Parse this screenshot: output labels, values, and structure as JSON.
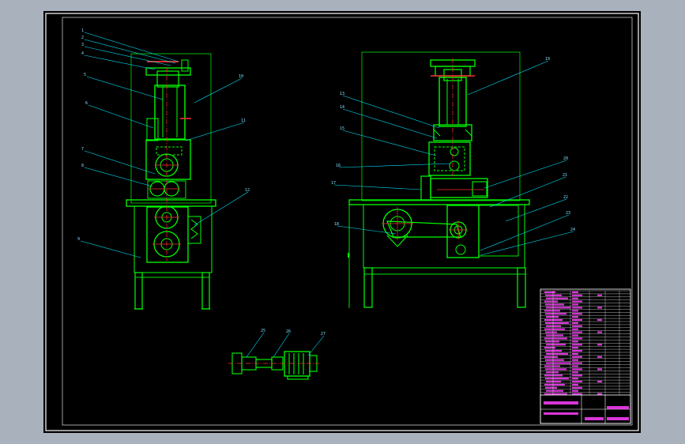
{
  "drawing": {
    "background_color": "#a9b1bd",
    "paper_color": "#000000",
    "frame_color": "#ffffff",
    "part_color": "#00ff00",
    "leader_color": "#00e5ff",
    "center_color": "#ff3030",
    "table_color": "#ff40ff"
  },
  "callouts": {
    "left_view": [
      "1",
      "2",
      "3",
      "4",
      "5",
      "6",
      "7",
      "8",
      "9",
      "10",
      "11",
      "12"
    ],
    "right_view": [
      "13",
      "14",
      "15",
      "16",
      "17",
      "18",
      "19",
      "20",
      "21",
      "22",
      "23",
      "24"
    ],
    "bottom_view": [
      "25",
      "26",
      "27"
    ]
  }
}
